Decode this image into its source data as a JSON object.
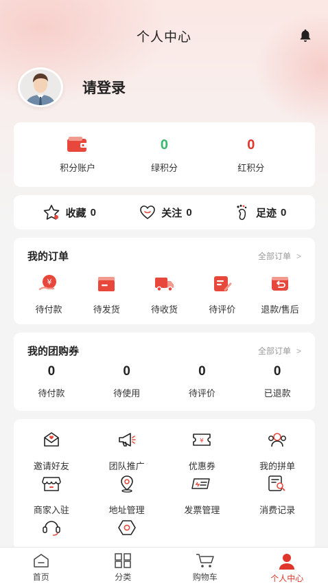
{
  "header": {
    "title": "个人中心",
    "bell_icon": "bell-icon"
  },
  "profile": {
    "avatar_icon": "avatar-icon",
    "login_text": "请登录"
  },
  "points": [
    {
      "label": "积分账户",
      "icon": "wallet-icon",
      "color": "#e8473c"
    },
    {
      "label": "绿积分",
      "value": "0",
      "color": "#39b76b"
    },
    {
      "label": "红积分",
      "value": "0",
      "color": "#e0352b"
    }
  ],
  "favorites": [
    {
      "label": "收藏",
      "count": "0",
      "icon": "star-icon"
    },
    {
      "label": "关注",
      "count": "0",
      "icon": "heart-icon"
    },
    {
      "label": "足迹",
      "count": "0",
      "icon": "footprint-icon"
    }
  ],
  "orders": {
    "title": "我的订单",
    "link": "全部订单",
    "items": [
      {
        "label": "待付款",
        "icon": "payment-icon"
      },
      {
        "label": "待发货",
        "icon": "package-icon"
      },
      {
        "label": "待收货",
        "icon": "truck-icon"
      },
      {
        "label": "待评价",
        "icon": "review-icon"
      },
      {
        "label": "退款/售后",
        "icon": "refund-icon"
      }
    ]
  },
  "coupons": {
    "title": "我的团购券",
    "link": "全部订单",
    "items": [
      {
        "label": "待付款",
        "value": "0"
      },
      {
        "label": "待使用",
        "value": "0"
      },
      {
        "label": "待评价",
        "value": "0"
      },
      {
        "label": "已退款",
        "value": "0"
      }
    ]
  },
  "services": [
    {
      "label": "邀请好友",
      "icon": "invite-envelope-icon"
    },
    {
      "label": "团队推广",
      "icon": "megaphone-icon"
    },
    {
      "label": "优惠券",
      "icon": "coupon-icon"
    },
    {
      "label": "我的拼单",
      "icon": "group-order-icon"
    },
    {
      "label": "商家入驻",
      "icon": "store-icon"
    },
    {
      "label": "地址管理",
      "icon": "location-icon"
    },
    {
      "label": "发票管理",
      "icon": "invoice-icon"
    },
    {
      "label": "消费记录",
      "icon": "record-search-icon"
    },
    {
      "label": "",
      "icon": "customer-service-icon"
    },
    {
      "label": "",
      "icon": "settings-icon"
    }
  ],
  "tabbar": [
    {
      "label": "首页",
      "icon": "home-icon"
    },
    {
      "label": "分类",
      "icon": "category-grid-icon"
    },
    {
      "label": "购物车",
      "icon": "cart-icon"
    },
    {
      "label": "个人中心",
      "icon": "person-icon",
      "active": true,
      "active_color": "#e0352b"
    }
  ]
}
